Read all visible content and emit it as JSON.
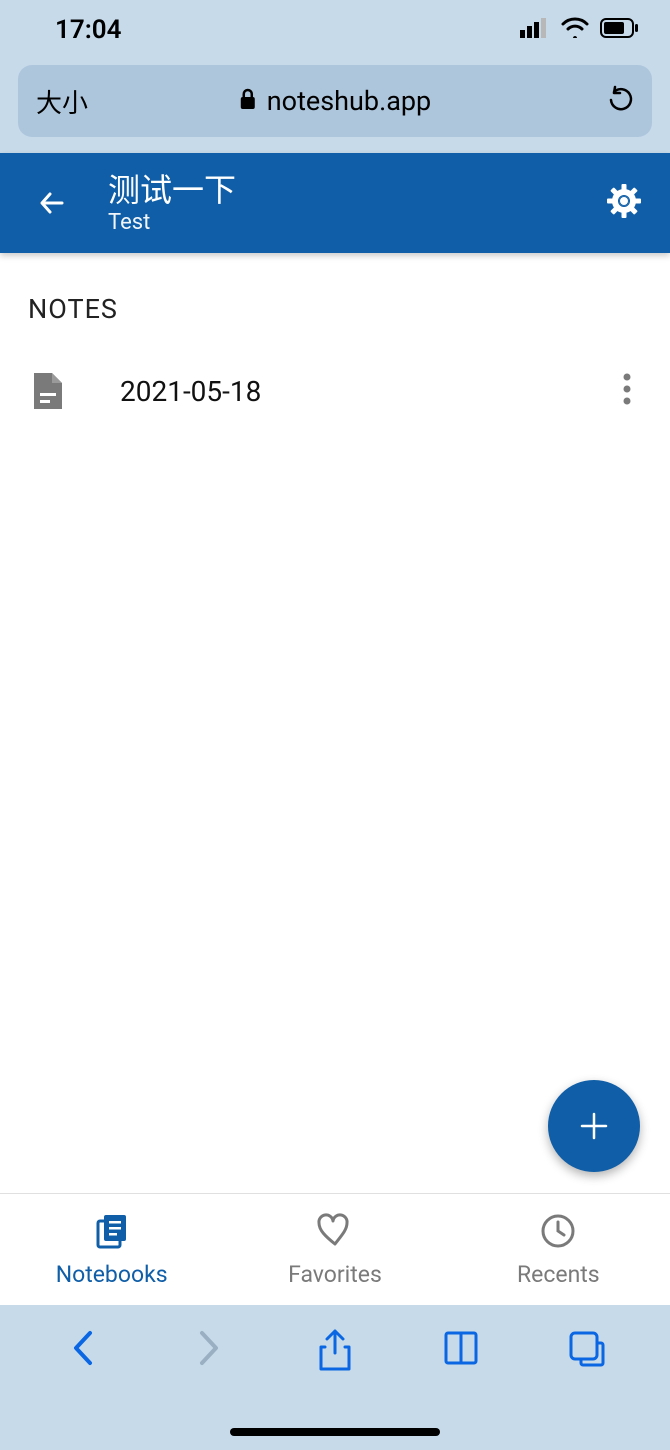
{
  "status": {
    "time": "17:04"
  },
  "browser": {
    "font_size_label": "大小",
    "domain": "noteshub.app"
  },
  "header": {
    "title": "测试一下",
    "subtitle": "Test"
  },
  "main": {
    "section_label": "NOTES",
    "notes": [
      {
        "title": "2021-05-18"
      }
    ]
  },
  "nav": {
    "items": [
      {
        "label": "Notebooks",
        "active": true
      },
      {
        "label": "Favorites",
        "active": false
      },
      {
        "label": "Recents",
        "active": false
      }
    ]
  },
  "colors": {
    "primary": "#0f5ea7",
    "ios_chrome": "#c6daea",
    "muted": "#7a7a7a"
  }
}
